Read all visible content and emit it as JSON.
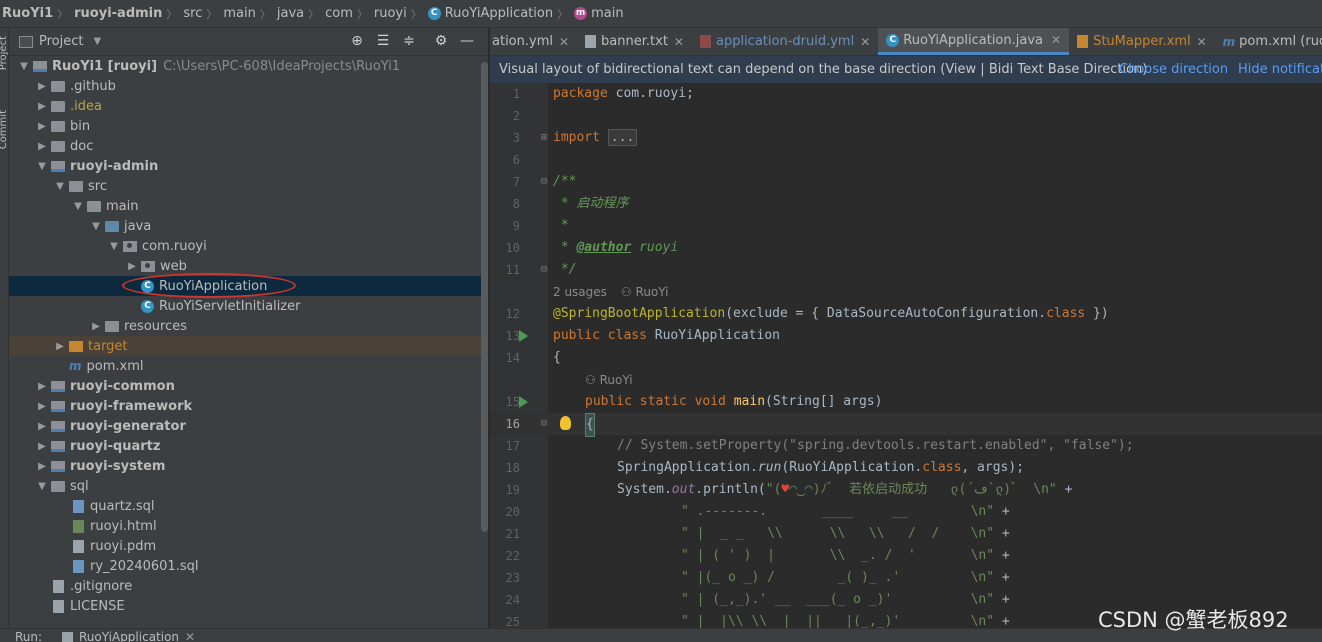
{
  "breadcrumb": [
    "RuoYi1",
    "ruoyi-admin",
    "src",
    "main",
    "java",
    "com",
    "ruoyi",
    "RuoYiApplication",
    "main"
  ],
  "left_strip": {
    "project_label": "Project",
    "commit_label": "Commit"
  },
  "project_panel": {
    "title": "Project",
    "tree": [
      {
        "label": "RuoYi1 [ruoyi]",
        "hint": "C:\\Users\\PC-608\\IdeaProjects\\RuoYi1"
      },
      {
        "label": ".github"
      },
      {
        "label": ".idea"
      },
      {
        "label": "bin"
      },
      {
        "label": "doc"
      },
      {
        "label": "ruoyi-admin"
      },
      {
        "label": "src"
      },
      {
        "label": "main"
      },
      {
        "label": "java"
      },
      {
        "label": "com.ruoyi"
      },
      {
        "label": "web"
      },
      {
        "label": "RuoYiApplication"
      },
      {
        "label": "RuoYiServletInitializer"
      },
      {
        "label": "resources"
      },
      {
        "label": "target"
      },
      {
        "label": "pom.xml"
      },
      {
        "label": "ruoyi-common"
      },
      {
        "label": "ruoyi-framework"
      },
      {
        "label": "ruoyi-generator"
      },
      {
        "label": "ruoyi-quartz"
      },
      {
        "label": "ruoyi-system"
      },
      {
        "label": "sql"
      },
      {
        "label": "quartz.sql"
      },
      {
        "label": "ruoyi.html"
      },
      {
        "label": "ruoyi.pdm"
      },
      {
        "label": "ry_20240601.sql"
      },
      {
        "label": ".gitignore"
      },
      {
        "label": "LICENSE"
      }
    ]
  },
  "tabs": [
    {
      "label": "ation.yml"
    },
    {
      "label": "banner.txt"
    },
    {
      "label": "application-druid.yml"
    },
    {
      "label": "RuoYiApplication.java"
    },
    {
      "label": "StuMapper.xml"
    },
    {
      "label": "pom.xml (ruoyi)"
    }
  ],
  "notice": {
    "text": "Visual layout of bidirectional text can depend on the base direction (View | Bidi Text Base Direction)",
    "choose": "Choose direction",
    "hide": "Hide notification"
  },
  "code": {
    "line_numbers": [
      "1",
      "2",
      "3",
      "6",
      "7",
      "8",
      "9",
      "10",
      "11",
      "12",
      "13",
      "14",
      "15",
      "16",
      "17",
      "18",
      "19",
      "20",
      "21",
      "22",
      "23",
      "24",
      "25"
    ],
    "pkg_kw": "package",
    "pkg_name": " com.ruoyi;",
    "import_kw": "import",
    "import_fold": "...",
    "doc_open": "/**",
    "doc_desc": " * 启动程序",
    "doc_blank": " *",
    "doc_star": " * ",
    "doc_author_tag": "@author",
    "doc_author": " ruoyi",
    "doc_close": " */",
    "usages": "2 usages",
    "usages_author": "RuoYi",
    "l12_ann": "@SpringBootApplication",
    "l12_rest": "(exclude = { DataSourceAutoConfiguration.",
    "l12_class": "class",
    "l12_end": " })",
    "l13_kw": "public class",
    "l13_name": " RuoYiApplication",
    "l14": "{",
    "author2": "RuoYi",
    "l15_kw": "public static void",
    "l15_fn": " main",
    "l15_rest": "(String[] args)",
    "l16": "{",
    "l17": "// System.setProperty(\"spring.devtools.restart.enabled\", \"false\");",
    "l18_a": "SpringApplication.",
    "l18_run": "run",
    "l18_b": "(RuoYiApplication.",
    "l18_class": "class",
    "l18_c": ", args);",
    "l19_a": "System.",
    "l19_out": "out",
    "l19_b": ".println(",
    "l19_str1": "\"(",
    "l19_heart": "♥",
    "l19_str2": "◠‿◠)ﾉﾞ  若依启动成功   ლ(´ڡ`ლ)ﾞ  \\n\"",
    "l19_plus": " +",
    "l20_str": "\" .-------.       ____     __        \\n\"",
    "l21_str": "\" |  _ _   \\\\      \\\\   \\\\   /  /    \\n\"",
    "l22_str": "\" | ( ' )  |       \\\\  _. /  '       \\n\"",
    "l23_str": "\" |(_ o _) /        _( )_ .'         \\n\"",
    "l24_str": "\" | (_,_).' __  ___(_ o _)'          \\n\"",
    "l25_str": "\" |  |\\\\ \\\\  |  ||   |(_,_)'         \\n\"",
    "plus": " +"
  },
  "bottom": {
    "run_label": "Run:",
    "run_tab": "RuoYiApplication"
  },
  "watermark": "CSDN @蟹老板892"
}
